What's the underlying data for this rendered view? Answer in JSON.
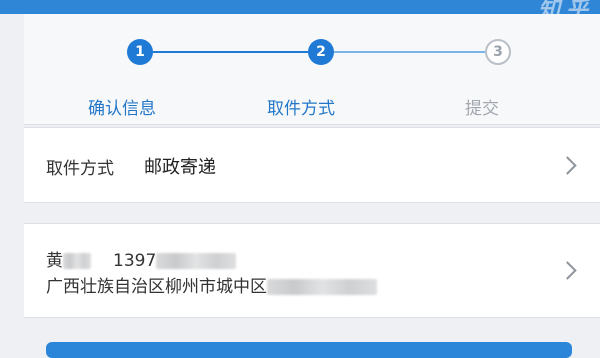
{
  "watermark": "知乎",
  "stepper": {
    "steps": [
      {
        "number": "1",
        "label": "确认信息",
        "state": "complete"
      },
      {
        "number": "2",
        "label": "取件方式",
        "state": "current"
      },
      {
        "number": "3",
        "label": "提交",
        "state": "pending"
      }
    ]
  },
  "pickup": {
    "label": "取件方式",
    "value": "邮政寄递"
  },
  "recipient": {
    "name_visible": "黄",
    "phone_visible": "1397",
    "address_visible": "广西壮族自治区柳州市城中区"
  },
  "colors": {
    "accent": "#1f7ad6",
    "pending": "#b9c0c7",
    "background": "#eef0f3"
  },
  "icons": {
    "row_arrow": "chevron-right-icon"
  }
}
